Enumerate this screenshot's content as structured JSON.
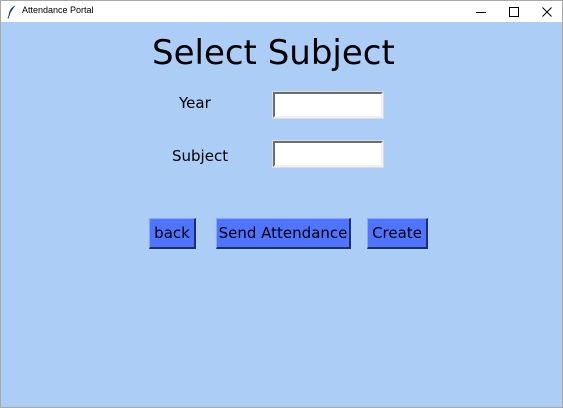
{
  "window": {
    "title": "Attendance Portal",
    "icon": "feather-icon"
  },
  "controls": {
    "minimize": "minimize-icon",
    "maximize": "maximize-icon",
    "close": "close-icon"
  },
  "form": {
    "heading": "Select Subject",
    "year_label": "Year",
    "year_value": "",
    "subject_label": "Subject",
    "subject_value": ""
  },
  "buttons": {
    "back": "back",
    "send": "Send Attendance",
    "create": "Create"
  },
  "colors": {
    "background": "#abcdf6",
    "button": "#4f74ff",
    "titlebar": "#ffffff"
  }
}
